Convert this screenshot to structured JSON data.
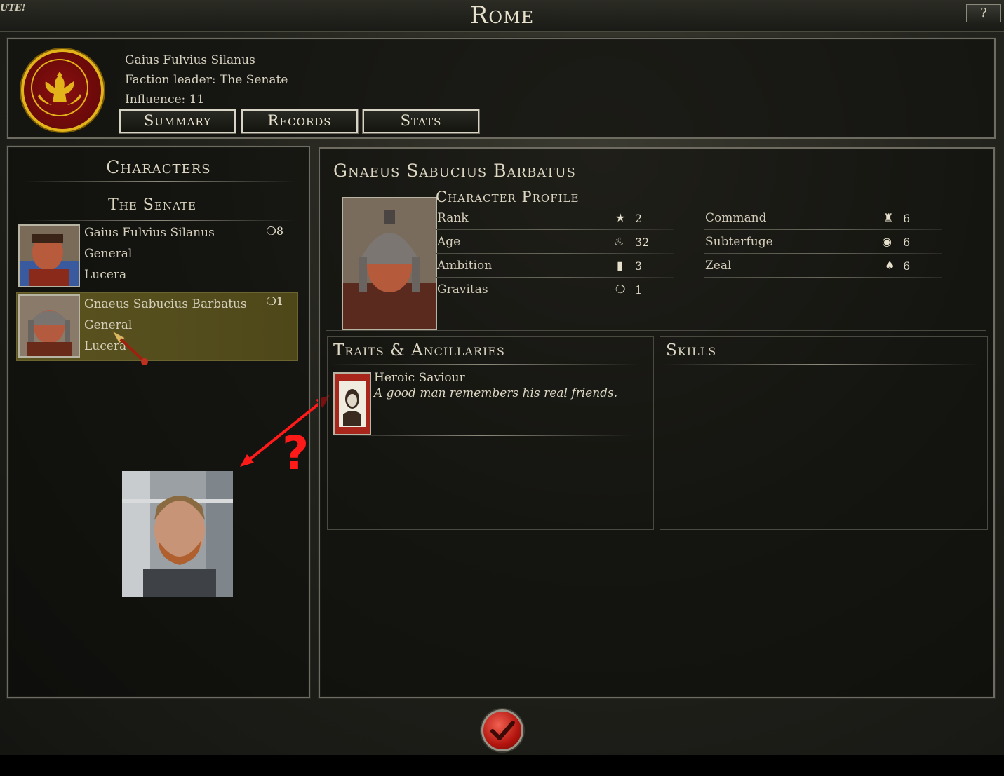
{
  "window": {
    "corner_label": "UTE!",
    "title": "Rome",
    "help_label": "?"
  },
  "faction": {
    "leader_name": "Gaius Fulvius Silanus",
    "faction_leader_line": "Faction leader: The Senate",
    "influence_line": "Influence: 11",
    "tabs": [
      "Summary",
      "Records",
      "Stats"
    ],
    "emblem_icon": "eagle-emblem-icon"
  },
  "characters_panel": {
    "heading": "Characters",
    "group_heading": "The Senate",
    "rows": [
      {
        "name": "Gaius Fulvius Silanus",
        "role": "General",
        "location": "Lucera",
        "gravitas": "8"
      },
      {
        "name": "Gnaeus Sabucius Barbatus",
        "role": "General",
        "location": "Lucera",
        "gravitas": "1"
      }
    ]
  },
  "detail": {
    "character_name": "Gnaeus Sabucius Barbatus",
    "profile_heading": "Character Profile",
    "stats_left": [
      {
        "label": "Rank",
        "value": "2",
        "icon": "star-icon"
      },
      {
        "label": "Age",
        "value": "32",
        "icon": "lamp-icon"
      },
      {
        "label": "Ambition",
        "value": "3",
        "icon": "scroll-icon"
      },
      {
        "label": "Gravitas",
        "value": "1",
        "icon": "laurel-icon"
      }
    ],
    "stats_right": [
      {
        "label": "Command",
        "value": "6",
        "icon": "helmet-icon"
      },
      {
        "label": "Subterfuge",
        "value": "6",
        "icon": "eye-icon"
      },
      {
        "label": "Zeal",
        "value": "6",
        "icon": "torch-icon"
      }
    ],
    "traits_heading": "Traits & Ancillaries",
    "skills_heading": "Skills",
    "trait": {
      "name": "Heroic Saviour",
      "description": "A good man remembers his real friends."
    }
  },
  "annotation": {
    "symbol": "?",
    "color": "#ff1a1a"
  },
  "colors": {
    "selected_row": "#5b5420",
    "accent_gold": "#e3b31a",
    "emblem_red": "#7a0c0c"
  }
}
